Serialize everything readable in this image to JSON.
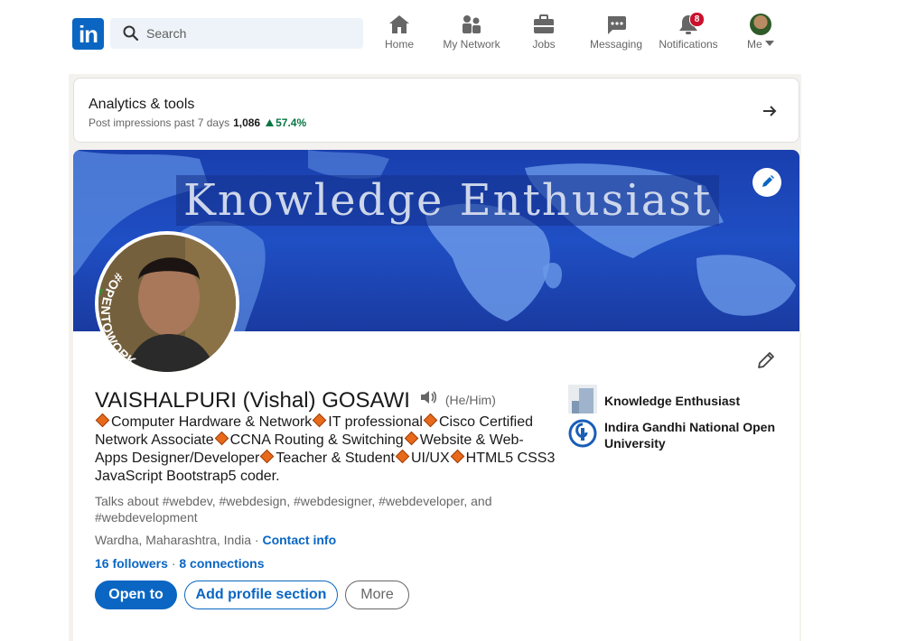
{
  "nav": {
    "logo_text": "in",
    "search_placeholder": "Search",
    "items": [
      {
        "label": "Home",
        "icon": "home-icon"
      },
      {
        "label": "My Network",
        "icon": "people-icon"
      },
      {
        "label": "Jobs",
        "icon": "briefcase-icon"
      },
      {
        "label": "Messaging",
        "icon": "chat-icon"
      },
      {
        "label": "Notifications",
        "icon": "bell-icon",
        "badge": "8"
      },
      {
        "label": "Me",
        "icon": "avatar-icon"
      }
    ]
  },
  "analytics": {
    "title": "Analytics & tools",
    "subtitle": "Post impressions past 7 days",
    "impressions": "1,086",
    "change": "57.4%"
  },
  "profile": {
    "banner_text": "Knowledge Enthusiast",
    "avatar_frame_text": "#OPENTOWORK",
    "name": "VAISHALPURI (Vishal) GOSAWI",
    "pronouns": "(He/Him)",
    "headline_parts": [
      "Computer Hardware & Network",
      "IT professional",
      "Cisco Certified Network Associate",
      "CCNA Routing & Switching",
      "Website & Web-Apps Designer/Developer",
      "Teacher & Student",
      "UI/UX",
      "HTML5 CSS3 JavaScript Bootstrap5 coder."
    ],
    "talks_about": "Talks about #webdev, #webdesign, #webdesigner, #webdeveloper, and #webdevelopment",
    "location": "Wardha, Maharashtra, India",
    "location_separator": "·",
    "contact_link": "Contact info",
    "followers": "16 followers",
    "conn_separator": "·",
    "connections": "8 connections",
    "buttons": {
      "open_to": "Open to",
      "add_section": "Add profile section",
      "more": "More"
    },
    "sidebar": [
      {
        "label": "Knowledge Enthusiast"
      },
      {
        "label": "Indira Gandhi National Open University"
      }
    ]
  },
  "colors": {
    "brand": "#0a66c2",
    "badge": "#cb112d",
    "positive": "#057642",
    "banner": "#1f4fc4",
    "opentowork": "#3d8a35"
  }
}
